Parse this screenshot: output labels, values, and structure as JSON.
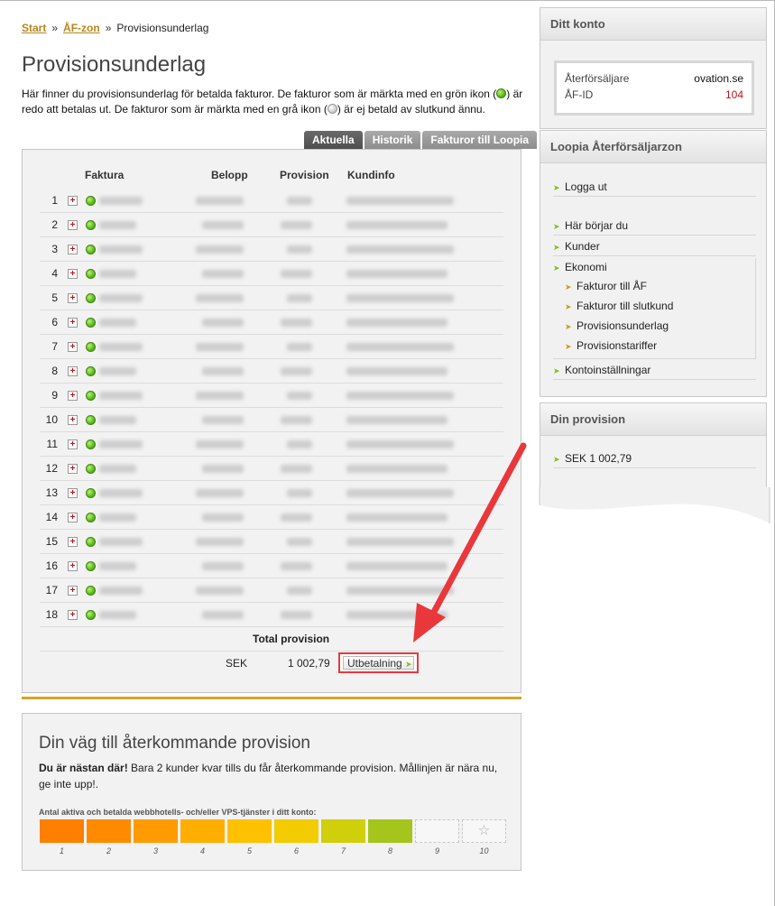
{
  "breadcrumb": {
    "start": "Start",
    "sep1": "»",
    "zone": "ÅF-zon",
    "sep2": "»",
    "current": "Provisionsunderlag"
  },
  "page": {
    "title": "Provisionsunderlag",
    "intro_part1": "Här finner du provisionsunderlag för betalda fakturor. De fakturor som är märkta med en grön ikon (",
    "intro_part2": ") är redo att betalas ut. De fakturor som är märkta med en grå ikon (",
    "intro_part3": ") är ej betald av slutkund ännu."
  },
  "tabs": [
    {
      "label": "Aktuella",
      "active": true
    },
    {
      "label": "Historik",
      "active": false
    },
    {
      "label": "Fakturor till Loopia",
      "active": false
    }
  ],
  "table": {
    "headers": {
      "invoice": "Faktura",
      "amount": "Belopp",
      "commission": "Provision",
      "customer": "Kundinfo"
    },
    "rows": [
      {
        "num": "1",
        "status": "green"
      },
      {
        "num": "2",
        "status": "green"
      },
      {
        "num": "3",
        "status": "green"
      },
      {
        "num": "4",
        "status": "green"
      },
      {
        "num": "5",
        "status": "green"
      },
      {
        "num": "6",
        "status": "green"
      },
      {
        "num": "7",
        "status": "green"
      },
      {
        "num": "8",
        "status": "green"
      },
      {
        "num": "9",
        "status": "green"
      },
      {
        "num": "10",
        "status": "green"
      },
      {
        "num": "11",
        "status": "green"
      },
      {
        "num": "12",
        "status": "green"
      },
      {
        "num": "13",
        "status": "green"
      },
      {
        "num": "14",
        "status": "green"
      },
      {
        "num": "15",
        "status": "green"
      },
      {
        "num": "16",
        "status": "green"
      },
      {
        "num": "17",
        "status": "green"
      },
      {
        "num": "18",
        "status": "green"
      }
    ],
    "expand_glyph": "+",
    "total_label": "Total provision",
    "currency": "SEK",
    "total_value": "1 002,79",
    "payout_label": "Utbetalning"
  },
  "progress": {
    "title": "Din väg till återkommande provision",
    "lead_bold": "Du är nästan där!",
    "lead_text": " Bara 2 kunder kvar tills du får återkommande provision. Mållinjen är nära nu, ge inte upp!.",
    "caption": "Antal aktiva och betalda webbhotells- och/eller VPS-tjänster i ditt konto:",
    "current": 8,
    "total": 10,
    "labels": [
      "1",
      "2",
      "3",
      "4",
      "5",
      "6",
      "7",
      "8",
      "9",
      "10"
    ],
    "colors": [
      "#ff7f00",
      "#ff8a00",
      "#ff9b00",
      "#ffae00",
      "#ffc000",
      "#f2cc00",
      "#cfcf0c",
      "#a5c51c",
      "#f7f7f7",
      "#f7f7f7"
    ],
    "goal_icon": "star-icon"
  },
  "sidebar": {
    "account": {
      "title": "Ditt konto",
      "reseller_label": "Återförsäljare",
      "reseller_value": "ovation.se",
      "id_label": "ÅF-ID",
      "id_value": "104"
    },
    "zone": {
      "title": "Loopia Återförsäljarzon",
      "logout": "Logga ut",
      "items": [
        "Här börjar du",
        "Kunder",
        "Ekonomi"
      ],
      "sub_items": [
        "Fakturor till ÅF",
        "Fakturor till slutkund",
        "Provisionsunderlag",
        "Provisionstariffer"
      ],
      "settings": "Kontoinställningar"
    },
    "commission": {
      "title": "Din provision",
      "value": "SEK 1 002,79"
    }
  },
  "colors": {
    "link": "#b8861e",
    "accent_gold": "#d6a325",
    "annotation_red": "#e8383c",
    "id_red": "#c0141b"
  }
}
